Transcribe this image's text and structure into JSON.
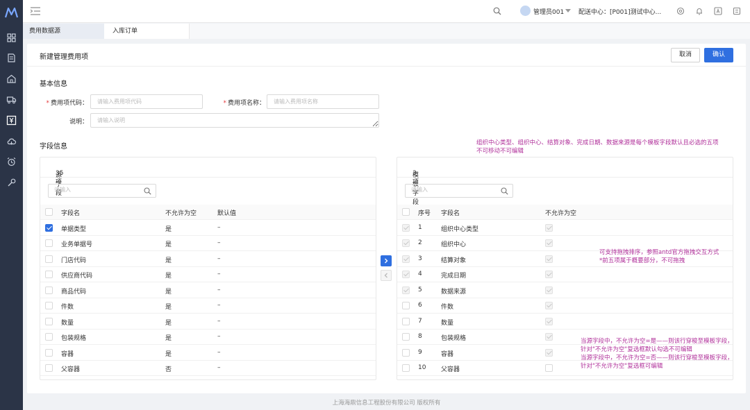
{
  "header": {
    "user_name": "管理员001",
    "center_label": "配送中心：[P001]测试中心..."
  },
  "tabs": [
    {
      "label": "费用数据源"
    },
    {
      "label": "入库订单"
    }
  ],
  "card": {
    "title": "新建管理费用项",
    "cancel_label": "取消",
    "ok_label": "确认"
  },
  "basic": {
    "section_title": "基本信息",
    "code_label": "费用项代码：",
    "code_placeholder": "请输入费用项代码",
    "name_label": "费用项名称：",
    "name_placeholder": "请输入费用项名称",
    "desc_label": "说明：",
    "desc_placeholder": "请输入说明"
  },
  "fields": {
    "section_title": "字段信息"
  },
  "annotations": {
    "top_line1": "组织中心类型、组织中心、结算对象、完成日期、数据来源是每个模板字段默认且必选的五项",
    "top_line2": "不可移动不可编辑",
    "mid_line1": "可支持拖拽排序，参照antd官方拖拽交互方式",
    "mid_line2": "*前五项属于概要部分，不可拖拽",
    "bottom_line1": "当源字段中，不允许为空=是——则该行穿梭至模板字段，",
    "bottom_line2": "针对\"不允许为空\"复选框默认勾选不可编辑",
    "bottom_line3": "当源字段中，不允许为空=否——则该行穿梭至模板字段，",
    "bottom_line4": "针对\"不允许为空\"复选框可编辑"
  },
  "source_panel": {
    "count": "35 项",
    "title": "源字段",
    "search_placeholder": "请输入",
    "columns": {
      "name": "字段名",
      "not_null": "不允许为空",
      "default": "默认值"
    },
    "rows": [
      {
        "name": "单据类型",
        "not_null": "是",
        "default": "–",
        "checked": true
      },
      {
        "name": "业务单据号",
        "not_null": "是",
        "default": "–",
        "checked": false
      },
      {
        "name": "门店代码",
        "not_null": "是",
        "default": "–",
        "checked": false
      },
      {
        "name": "供应商代码",
        "not_null": "是",
        "default": "–",
        "checked": false
      },
      {
        "name": "商品代码",
        "not_null": "是",
        "default": "–",
        "checked": false
      },
      {
        "name": "件数",
        "not_null": "是",
        "default": "–",
        "checked": false
      },
      {
        "name": "数量",
        "not_null": "是",
        "default": "–",
        "checked": false
      },
      {
        "name": "包装规格",
        "not_null": "是",
        "default": "–",
        "checked": false
      },
      {
        "name": "容器",
        "not_null": "是",
        "default": "–",
        "checked": false
      },
      {
        "name": "父容器",
        "not_null": "否",
        "default": "–",
        "checked": false
      }
    ]
  },
  "target_panel": {
    "count": "3 项",
    "title": "模板字段",
    "search_placeholder": "请输入",
    "columns": {
      "index": "序号",
      "name": "字段名",
      "not_null": "不允许为空"
    },
    "rows": [
      {
        "index": "1",
        "name": "组织中心类型",
        "locked": true,
        "not_null_disabled": true
      },
      {
        "index": "2",
        "name": "组织中心",
        "locked": true,
        "not_null_disabled": true
      },
      {
        "index": "3",
        "name": "结算对象",
        "locked": true,
        "not_null_disabled": true
      },
      {
        "index": "4",
        "name": "完成日期",
        "locked": true,
        "not_null_disabled": true
      },
      {
        "index": "5",
        "name": "数据来源",
        "locked": true,
        "not_null_disabled": true
      },
      {
        "index": "6",
        "name": "件数",
        "locked": false,
        "not_null_disabled": true
      },
      {
        "index": "7",
        "name": "数量",
        "locked": false,
        "not_null_disabled": true
      },
      {
        "index": "8",
        "name": "包装规格",
        "locked": false,
        "not_null_disabled": true
      },
      {
        "index": "9",
        "name": "容器",
        "locked": false,
        "not_null_disabled": true
      },
      {
        "index": "10",
        "name": "父容器",
        "locked": false,
        "not_null_disabled": false
      }
    ]
  },
  "footer": {
    "text": "上海海鼎信息工程股份有限公司 版权所有"
  }
}
